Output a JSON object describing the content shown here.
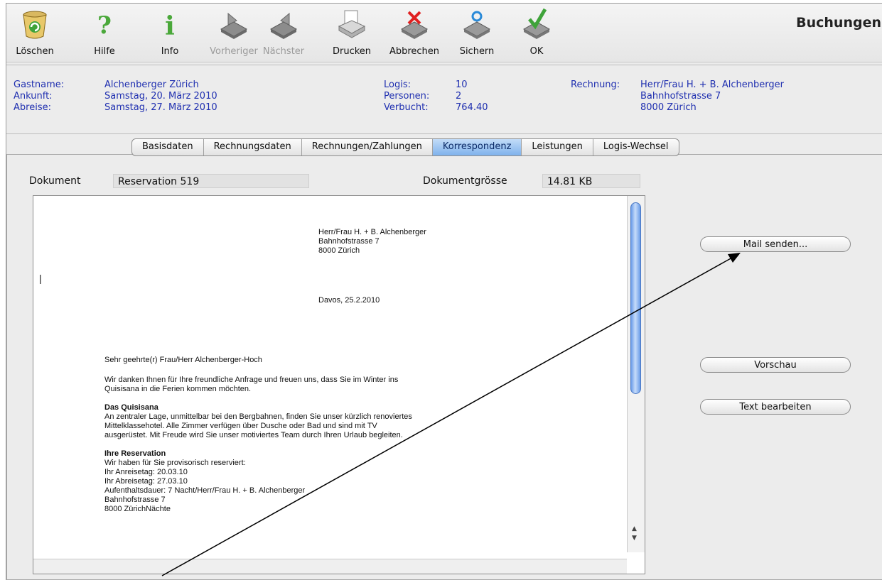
{
  "window": {
    "title": "Buchungen"
  },
  "toolbar": {
    "items": [
      {
        "label": "Löschen",
        "icon": "trash-icon",
        "enabled": true
      },
      {
        "label": "Hilfe",
        "icon": "help-icon",
        "enabled": true
      },
      {
        "label": "Info",
        "icon": "info-icon",
        "enabled": true
      },
      {
        "label": "Vorheriger",
        "icon": "previous-icon",
        "enabled": false
      },
      {
        "label": "Nächster",
        "icon": "next-icon",
        "enabled": false
      },
      {
        "label": "Drucken",
        "icon": "printer-icon",
        "enabled": true
      },
      {
        "label": "Abbrechen",
        "icon": "cancel-icon",
        "enabled": true
      },
      {
        "label": "Sichern",
        "icon": "save-icon",
        "enabled": true
      },
      {
        "label": "OK",
        "icon": "ok-icon",
        "enabled": true
      }
    ]
  },
  "info": {
    "gastname_label": "Gastname:",
    "gastname": "Alchenberger Zürich",
    "ankunft_label": "Ankunft:",
    "ankunft": "Samstag, 20. März 2010",
    "abreise_label": "Abreise:",
    "abreise": "Samstag, 27. März 2010",
    "logis_label": "Logis:",
    "logis": "10",
    "personen_label": "Personen:",
    "personen": "2",
    "verbucht_label": "Verbucht:",
    "verbucht": "764.40",
    "rechnung_label": "Rechnung:",
    "rechnung_line1": "Herr/Frau H. + B. Alchenberger",
    "rechnung_line2": "Bahnhofstrasse 7",
    "rechnung_line3": "8000 Zürich"
  },
  "tabs": [
    {
      "label": "Basisdaten",
      "active": false
    },
    {
      "label": "Rechnungsdaten",
      "active": false
    },
    {
      "label": "Rechnungen/Zahlungen",
      "active": false
    },
    {
      "label": "Korrespondenz",
      "active": true
    },
    {
      "label": "Leistungen",
      "active": false
    },
    {
      "label": "Logis-Wechsel",
      "active": false
    }
  ],
  "document": {
    "label": "Dokument",
    "name": "Reservation  519",
    "size_label": "Dokumentgrösse",
    "size": "14.81 KB"
  },
  "letter": {
    "addr1": "Herr/Frau H. + B. Alchenberger",
    "addr2": "Bahnhofstrasse 7",
    "addr3": "8000 Zürich",
    "date": "Davos, 25.2.2010",
    "salutation": "Sehr geehrte(r) Frau/Herr Alchenberger-Hoch",
    "p1_l1": "Wir danken Ihnen für Ihre freundliche Anfrage und freuen uns, dass Sie  im Winter ins",
    "p1_l2": "Quisisana in die Ferien kommen möchten.",
    "h1": "Das Quisisana",
    "p2_l1": "An zentraler Lage, unmittelbar bei den Bergbahnen, finden Sie unser kürzlich renoviertes",
    "p2_l2": "Mittelklassehotel. Alle Zimmer verfügen über Dusche oder Bad und sind mit TV",
    "p2_l3": "ausgerüstet. Mit Freude wird Sie unser motiviertes Team durch Ihren Urlaub begleiten.",
    "h2": "Ihre Reservation",
    "p3_l1": "Wir haben für Sie provisorisch reserviert:",
    "p3_l2": "Ihr Anreisetag: 20.03.10",
    "p3_l3": "Ihr Abreisetag: 27.03.10",
    "p3_l4": "Aufenthaltsdauer: 7 Nacht/Herr/Frau H. + B. Alchenberger",
    "p3_l5": "Bahnhofstrasse 7",
    "p3_l6": "8000 ZürichNächte"
  },
  "buttons": {
    "mail": "Mail senden...",
    "preview": "Vorschau",
    "edit": "Text bearbeiten"
  }
}
